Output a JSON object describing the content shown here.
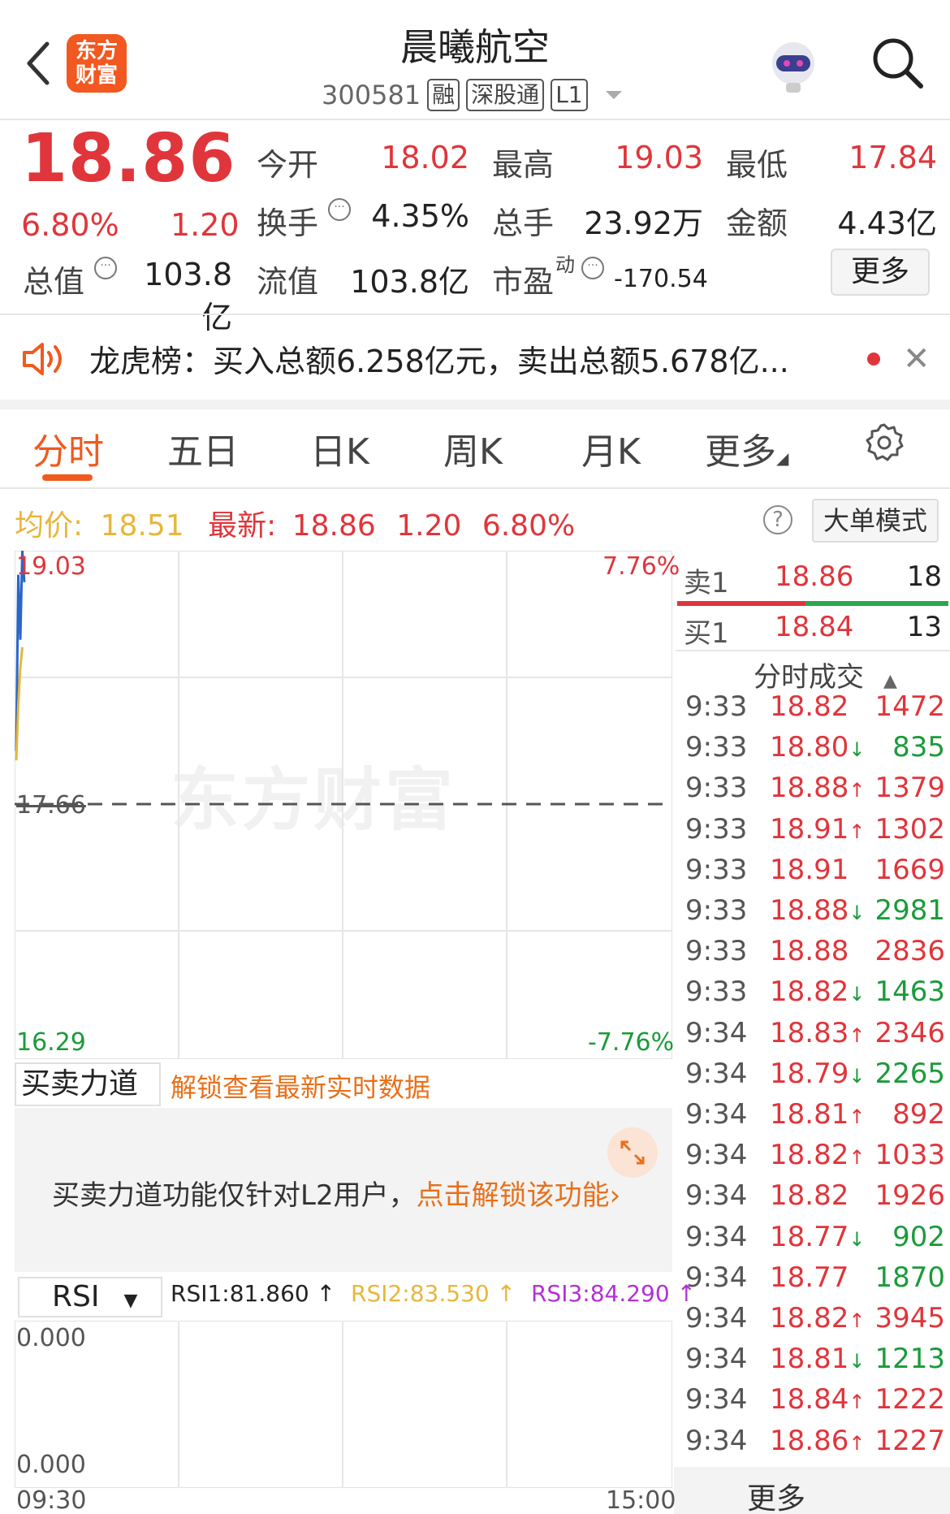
{
  "header": {
    "title": "晨曦航空",
    "code": "300581",
    "tags": [
      "融",
      "深股通",
      "L1"
    ],
    "logo_line1": "东方",
    "logo_line2": "财富"
  },
  "quote": {
    "price": "18.86",
    "change_pct": "6.80%",
    "change": "1.20",
    "open_label": "今开",
    "open": "18.02",
    "high_label": "最高",
    "high": "19.03",
    "low_label": "最低",
    "low": "17.84",
    "turnover_label": "换手",
    "turnover": "4.35%",
    "volume_label": "总手",
    "volume": "23.92万",
    "amount_label": "金额",
    "amount": "4.43亿",
    "mktcap_label": "总值",
    "mktcap": "103.8亿",
    "float_label": "流值",
    "float_cap": "103.8亿",
    "pe_label": "市盈",
    "pe_sup": "动",
    "pe": "-170.54",
    "more_label": "更多"
  },
  "notice": {
    "text": "龙虎榜：买入总额6.258亿元，卖出总额5.678亿..."
  },
  "tabs": [
    "分时",
    "五日",
    "日K",
    "周K",
    "月K",
    "更多"
  ],
  "info": {
    "avg_label": "均价:",
    "avg": "18.51",
    "latest_label": "最新:",
    "latest": "18.86",
    "change": "1.20",
    "change_pct": "6.80%",
    "bigorder_label": "大单模式"
  },
  "chart_axis": {
    "y_top": "19.03",
    "y_mid": "17.66",
    "y_bottom": "16.29",
    "pct_top": "7.76%",
    "pct_bottom": "-7.76%",
    "time_start": "09:30",
    "time_end": "15:00"
  },
  "watermark": "东方财富",
  "chart_data": {
    "type": "line",
    "title": "",
    "ylim": [
      16.29,
      19.03
    ],
    "reference_price": 17.66,
    "series": [
      {
        "values": [
          17.95,
          18.9,
          18.55,
          19.03,
          18.86
        ]
      },
      {
        "values": [
          17.9,
          18.2,
          18.4,
          18.51
        ]
      }
    ]
  },
  "orderbook": {
    "sell_label": "卖1",
    "sell_price": "18.86",
    "sell_vol": "18",
    "buy_label": "买1",
    "buy_price": "18.84",
    "buy_vol": "13",
    "ticks_title": "分时成交"
  },
  "ticks": [
    {
      "time": "9:33",
      "price": "18.82",
      "arrow": "",
      "vol": "1472",
      "vol_color": "red"
    },
    {
      "time": "9:33",
      "price": "18.80",
      "arrow": "↓",
      "vol": "835",
      "vol_color": "green"
    },
    {
      "time": "9:33",
      "price": "18.88",
      "arrow": "↑",
      "vol": "1379",
      "vol_color": "red"
    },
    {
      "time": "9:33",
      "price": "18.91",
      "arrow": "↑",
      "vol": "1302",
      "vol_color": "red"
    },
    {
      "time": "9:33",
      "price": "18.91",
      "arrow": "",
      "vol": "1669",
      "vol_color": "red"
    },
    {
      "time": "9:33",
      "price": "18.88",
      "arrow": "↓",
      "vol": "2981",
      "vol_color": "green"
    },
    {
      "time": "9:33",
      "price": "18.88",
      "arrow": "",
      "vol": "2836",
      "vol_color": "red"
    },
    {
      "time": "9:33",
      "price": "18.82",
      "arrow": "↓",
      "vol": "1463",
      "vol_color": "green"
    },
    {
      "time": "9:34",
      "price": "18.83",
      "arrow": "↑",
      "vol": "2346",
      "vol_color": "red"
    },
    {
      "time": "9:34",
      "price": "18.79",
      "arrow": "↓",
      "vol": "2265",
      "vol_color": "green"
    },
    {
      "time": "9:34",
      "price": "18.81",
      "arrow": "↑",
      "vol": "892",
      "vol_color": "red"
    },
    {
      "time": "9:34",
      "price": "18.82",
      "arrow": "↑",
      "vol": "1033",
      "vol_color": "red"
    },
    {
      "time": "9:34",
      "price": "18.82",
      "arrow": "",
      "vol": "1926",
      "vol_color": "red"
    },
    {
      "time": "9:34",
      "price": "18.77",
      "arrow": "↓",
      "vol": "902",
      "vol_color": "green"
    },
    {
      "time": "9:34",
      "price": "18.77",
      "arrow": "",
      "vol": "1870",
      "vol_color": "green"
    },
    {
      "time": "9:34",
      "price": "18.82",
      "arrow": "↑",
      "vol": "3945",
      "vol_color": "red"
    },
    {
      "time": "9:34",
      "price": "18.81",
      "arrow": "↓",
      "vol": "1213",
      "vol_color": "green"
    },
    {
      "time": "9:34",
      "price": "18.84",
      "arrow": "↑",
      "vol": "1222",
      "vol_color": "red"
    },
    {
      "time": "9:34",
      "price": "18.86",
      "arrow": "↑",
      "vol": "1227",
      "vol_color": "red"
    }
  ],
  "ticks_more": "更多",
  "force": {
    "select": "买卖力道",
    "unlock": "解锁查看最新实时数据",
    "msg": "买卖力道功能仅针对L2用户，",
    "msg_link": "点击解锁该功能"
  },
  "rsi": {
    "select": "RSI",
    "rsi1": "RSI1:81.860 ↑",
    "rsi2": "RSI2:83.530 ↑",
    "rsi3": "RSI3:84.290 ↑",
    "y_top": "0.000",
    "y_bottom": "0.000"
  },
  "colors": {
    "up": "#e0353b",
    "down": "#1a9b3a",
    "accent": "#f05a1e",
    "avg": "#e8b63a",
    "rsi3": "#b52fd6"
  }
}
